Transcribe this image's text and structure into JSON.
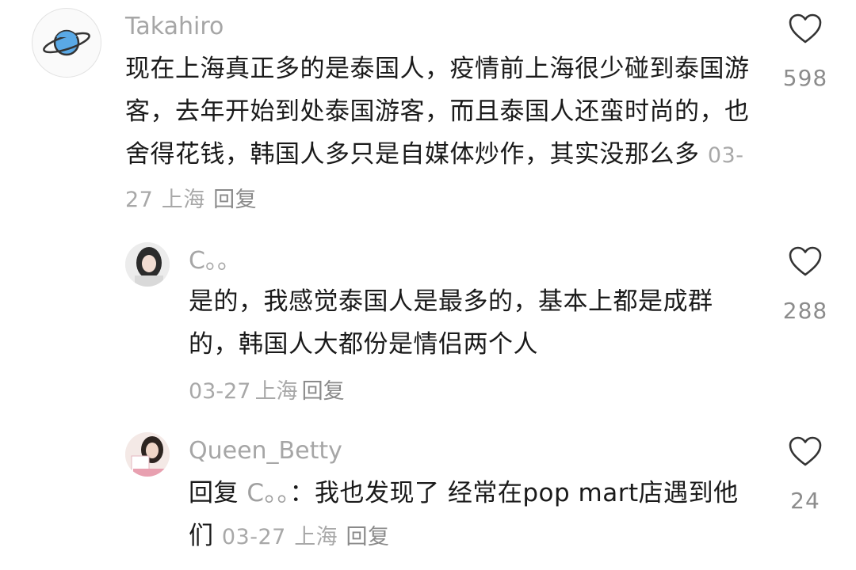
{
  "comments": [
    {
      "username": "Takahiro",
      "text": "现在上海真正多的是泰国人，疫情前上海很少碰到泰国游客，去年开始到处泰国游客，而且泰国人还蛮时尚的，也舍得花钱，韩国人多只是自媒体炒作，其实没那么多",
      "date": "03-27",
      "location": "上海",
      "reply_label": "回复",
      "likes": "598",
      "avatar_icon": "planet-icon"
    },
    {
      "username": "C。。",
      "text": "是的，我感觉泰国人是最多的，基本上都是成群的，韩国人大都份是情侣两个人",
      "date": "03-27",
      "location": "上海",
      "reply_label": "回复",
      "likes": "288",
      "avatar_icon": "user-photo-avatar"
    },
    {
      "username": "Queen_Betty",
      "reply_prefix": "回复",
      "mention": "C。。",
      "text": "：我也发现了 经常在pop mart店遇到他们",
      "date": "03-27",
      "location": "上海",
      "reply_label": "回复",
      "likes": "24",
      "avatar_icon": "user-photo-avatar"
    }
  ],
  "colors": {
    "username": "#a6a6a6",
    "body_text": "#1a1a1a",
    "meta": "#a8a8a8",
    "heart_outline": "#333333",
    "planet": "#5aa9e6"
  },
  "icons": {
    "like": "heart-outline-icon"
  }
}
